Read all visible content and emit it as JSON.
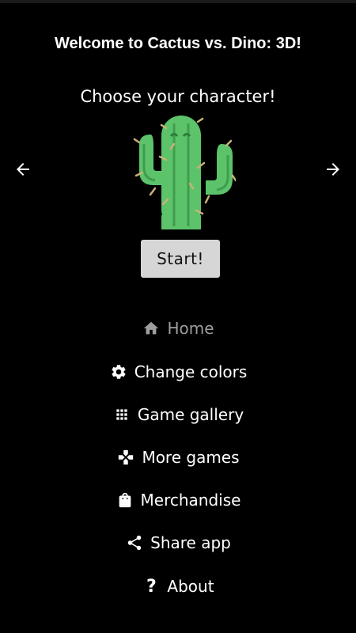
{
  "title": "Welcome to Cactus vs. Dino: 3D!",
  "subtitle": "Choose your character!",
  "carousel": {
    "prev_icon": "arrow-left-icon",
    "next_icon": "arrow-right-icon",
    "current_character_icon": "cactus-icon"
  },
  "start_label": "Start!",
  "menu": {
    "items": [
      {
        "label": "Home",
        "icon": "home-icon",
        "active": true
      },
      {
        "label": "Change colors",
        "icon": "gear-icon",
        "active": false
      },
      {
        "label": "Game gallery",
        "icon": "grid-icon",
        "active": false
      },
      {
        "label": "More games",
        "icon": "gamepad-icon",
        "active": false
      },
      {
        "label": "Merchandise",
        "icon": "shopping-bag-icon",
        "active": false
      },
      {
        "label": "Share app",
        "icon": "share-icon",
        "active": false
      },
      {
        "label": "About",
        "icon": "question-icon",
        "active": false
      }
    ]
  },
  "colors": {
    "background": "#000000",
    "text": "#ffffff",
    "active_menu": "#9e9e9e",
    "button": "#d6d6d6",
    "cactus": "#5cc36a"
  }
}
